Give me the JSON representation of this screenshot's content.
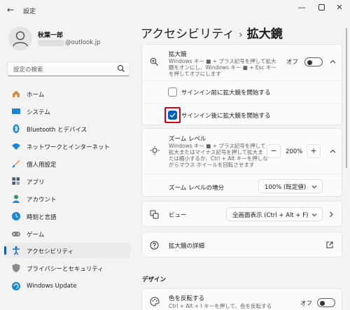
{
  "window": {
    "title": "設定",
    "back_icon": "back-arrow-icon",
    "controls": [
      "minimize",
      "maximize",
      "close"
    ]
  },
  "user": {
    "name": "秋葉一郎",
    "email_visible": "@outlook.jp"
  },
  "search": {
    "placeholder": "設定の検索"
  },
  "sidebar": {
    "items": [
      {
        "label": "ホーム",
        "icon": "home-icon",
        "color": "#c07a2c"
      },
      {
        "label": "システム",
        "icon": "system-icon",
        "color": "#1a86d6"
      },
      {
        "label": "Bluetooth とデバイス",
        "icon": "bluetooth-icon",
        "color": "#1a86d6"
      },
      {
        "label": "ネットワークとインターネット",
        "icon": "wifi-icon",
        "color": "#1a86d6"
      },
      {
        "label": "個人用設定",
        "icon": "brush-icon",
        "color": "#d98a26"
      },
      {
        "label": "アプリ",
        "icon": "apps-icon",
        "color": "#4a5b78"
      },
      {
        "label": "アカウント",
        "icon": "account-icon",
        "color": "#2e9d54"
      },
      {
        "label": "時刻と言語",
        "icon": "time-language-icon",
        "color": "#1a86d6"
      },
      {
        "label": "ゲーム",
        "icon": "game-icon",
        "color": "#777777"
      },
      {
        "label": "アクセシビリティ",
        "icon": "accessibility-icon",
        "color": "#1a6fc4"
      },
      {
        "label": "プライバシーとセキュリティ",
        "icon": "shield-icon",
        "color": "#777777"
      },
      {
        "label": "Windows Update",
        "icon": "windows-update-icon",
        "color": "#1a86d6"
      }
    ],
    "active_index": 9
  },
  "breadcrumb": {
    "parent": "アクセシビリティ",
    "separator": "›",
    "current": "拡大鏡"
  },
  "magnifier": {
    "title": "拡大鏡",
    "desc": "Windows キー ■ + プラス記号を押して拡大鏡をオンにし、Windows キー ■ + Esc キーを押してオフにします",
    "state_label": "オフ",
    "option_before": "サインイン前に拡大鏡を開始する",
    "option_after": "サインイン後に拡大鏡を開始する"
  },
  "zoom": {
    "title": "ズーム レベル",
    "desc": "Windows キー ■ + プラス記号を押して拡大またはマイナス記号を押して拡大または縮小するか、Ctrl + Alt キーを押しながらマウス ホイールを回転させます",
    "minus": "−",
    "value": "200%",
    "plus": "+",
    "increment_label": "ズーム レベルの増分",
    "increment_value": "100% (既定値)"
  },
  "view": {
    "title": "ビュー",
    "value": "全画面表示 (Ctrl + Alt + F)"
  },
  "details": {
    "title": "拡大鏡の詳細"
  },
  "design": {
    "section": "デザイン",
    "invert_title": "色を反転する",
    "invert_desc": "Ctrl + Alt + I キーを押して、色を反転する",
    "invert_state": "オフ"
  },
  "colors": {
    "accent": "#005fb8",
    "highlight": "#d6001c"
  }
}
